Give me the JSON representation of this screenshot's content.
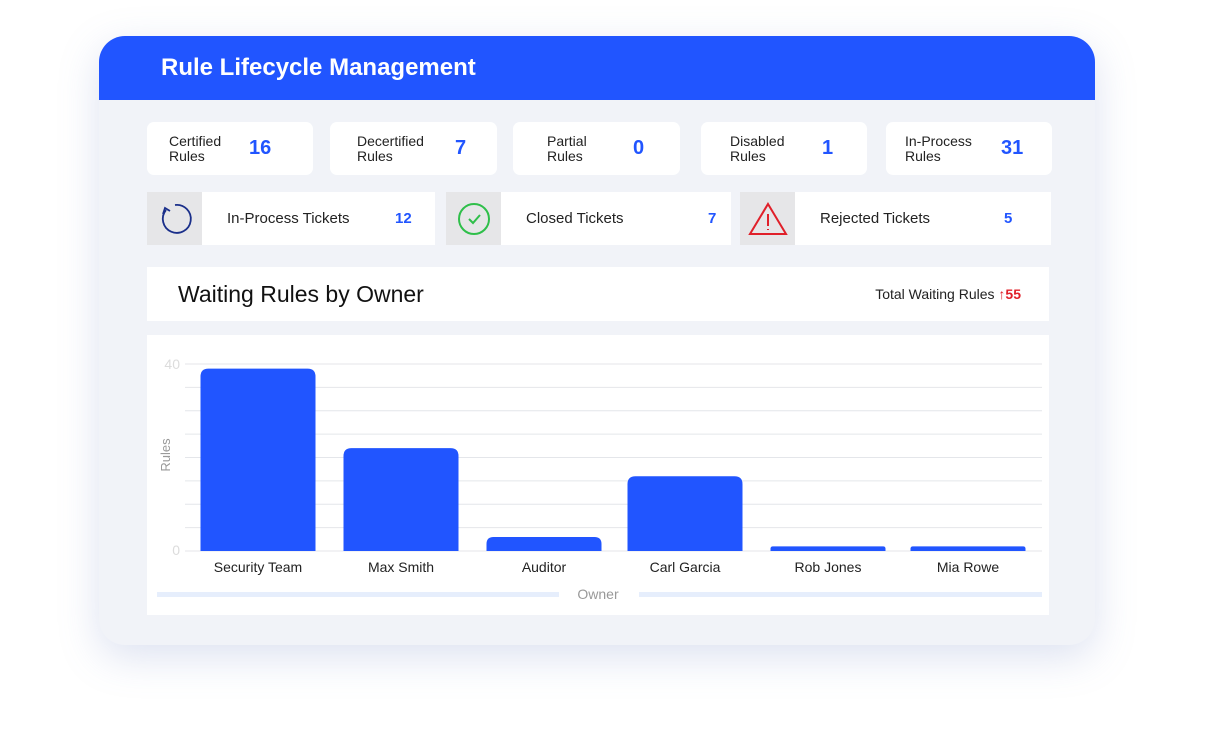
{
  "title": "Rule Lifecycle Management",
  "stats": [
    {
      "label1": "Certified",
      "label2": "Rules",
      "value": "16"
    },
    {
      "label1": "Decertified",
      "label2": "Rules",
      "value": "7"
    },
    {
      "label1": "Partial",
      "label2": "Rules",
      "value": "0"
    },
    {
      "label1": "Disabled",
      "label2": "Rules",
      "value": "1"
    },
    {
      "label1": "In-Process",
      "label2": "Rules",
      "value": "31"
    }
  ],
  "tickets": [
    {
      "label": "In-Process Tickets",
      "value": "12",
      "icon": "refresh-icon"
    },
    {
      "label": "Closed Tickets",
      "value": "7",
      "icon": "check-circle-icon"
    },
    {
      "label": "Rejected Tickets",
      "value": "5",
      "icon": "warning-icon"
    }
  ],
  "chart_header": {
    "title": "Waiting Rules by Owner",
    "total_label": "Total Waiting Rules",
    "total_value": "55",
    "trend": "↑"
  },
  "colors": {
    "accent": "#2155ff",
    "danger": "#e0202a"
  },
  "chart_data": {
    "type": "bar",
    "title": "Waiting Rules by Owner",
    "xlabel": "Owner",
    "ylabel": "Rules",
    "ylim": [
      0,
      40
    ],
    "yticks": [
      "0",
      "40"
    ],
    "grid": true,
    "categories": [
      "Security Team",
      "Max Smith",
      "Auditor",
      "Carl Garcia",
      "Rob Jones",
      "Mia Rowe"
    ],
    "values": [
      39,
      22,
      3,
      16,
      1,
      1
    ]
  }
}
